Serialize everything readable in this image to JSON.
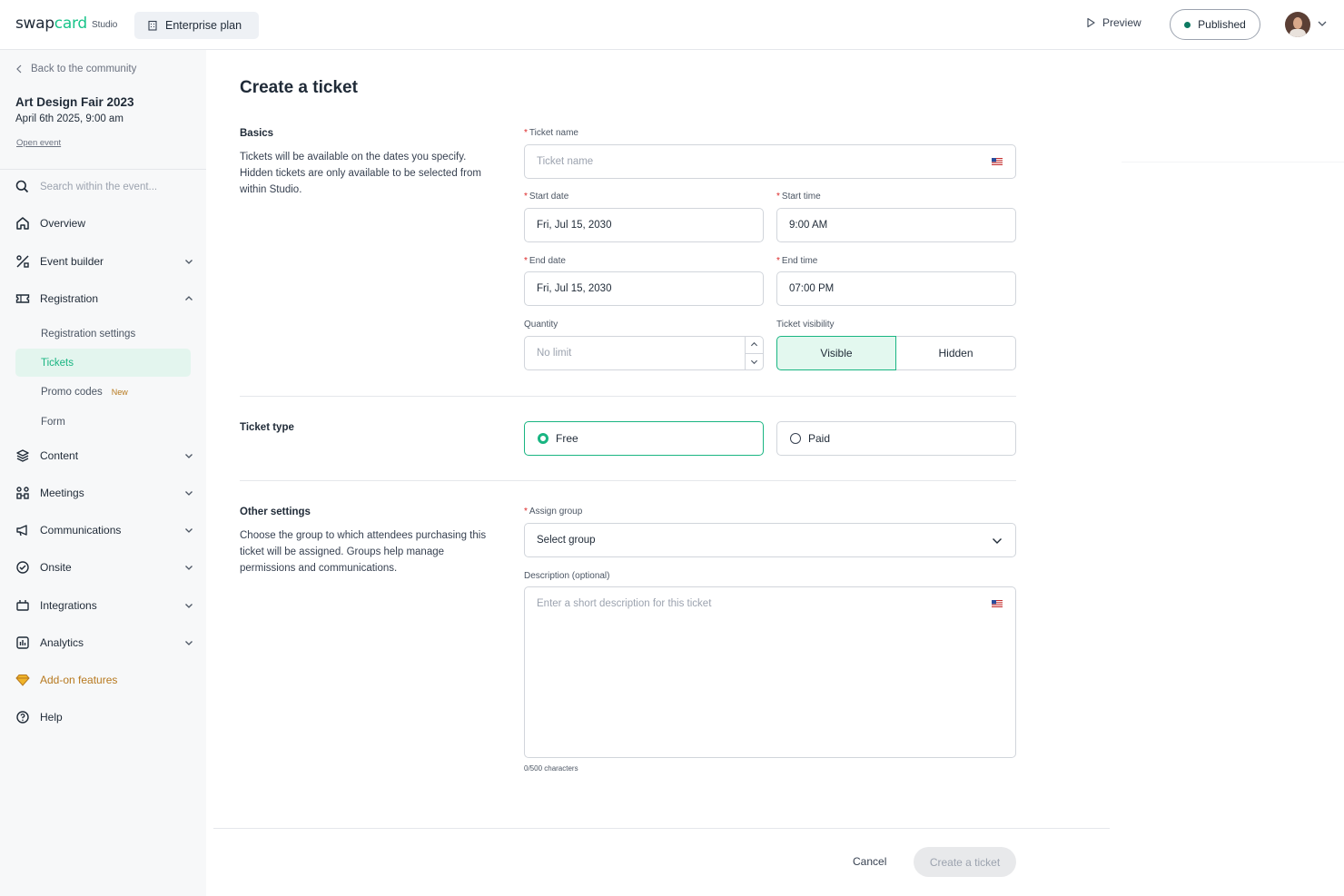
{
  "topbar": {
    "logo_text_a": "swap",
    "logo_text_b": "card",
    "studio_label": "Studio",
    "plan_label": "Enterprise plan",
    "preview_label": "Preview",
    "published_label": "Published",
    "status_color": "#0e7a62"
  },
  "sidebar": {
    "back_label": "Back to the community",
    "event_title": "Art Design Fair 2023",
    "event_date": "April 6th 2025, 9:00 am",
    "open_event_label": "Open event",
    "search_placeholder": "Search within the event...",
    "items": [
      {
        "label": "Overview",
        "icon": "home-icon"
      },
      {
        "label": "Event builder",
        "icon": "tools-icon"
      },
      {
        "label": "Registration",
        "icon": "ticket-icon"
      },
      {
        "label": "Content",
        "icon": "layers-icon"
      },
      {
        "label": "Meetings",
        "icon": "meetings-icon"
      },
      {
        "label": "Communications",
        "icon": "megaphone-icon"
      },
      {
        "label": "Onsite",
        "icon": "badge-check-icon"
      },
      {
        "label": "Integrations",
        "icon": "plug-icon"
      },
      {
        "label": "Analytics",
        "icon": "chart-icon"
      },
      {
        "label": "Add-on features",
        "icon": "diamond-icon"
      },
      {
        "label": "Help",
        "icon": "help-icon"
      }
    ],
    "registration_sub": [
      {
        "label": "Registration settings"
      },
      {
        "label": "Tickets",
        "active": true
      },
      {
        "label": "Promo codes",
        "badge": "New"
      },
      {
        "label": "Form"
      }
    ],
    "accent_color": "#19b582",
    "addon_color": "#b7791f"
  },
  "main": {
    "title": "Create a ticket",
    "basics": {
      "title": "Basics",
      "description": "Tickets will be available on the dates you specify. Hidden tickets are only available to be selected from within Studio.",
      "ticket_name_label": "Ticket name",
      "ticket_name_placeholder": "Ticket name",
      "start_date_label": "Start date",
      "start_date_value": "Fri, Jul 15, 2030",
      "start_time_label": "Start time",
      "start_time_value": "9:00 AM",
      "end_date_label": "End date",
      "end_date_value": "Fri, Jul 15, 2030",
      "end_time_label": "End time",
      "end_time_value": "07:00 PM",
      "quantity_label": "Quantity",
      "quantity_placeholder": "No limit",
      "visibility_label": "Ticket visibility",
      "visible_label": "Visible",
      "hidden_label": "Hidden",
      "visibility_selected": "Visible"
    },
    "ticket_type": {
      "title": "Ticket type",
      "free_label": "Free",
      "paid_label": "Paid",
      "selected": "Free"
    },
    "other": {
      "title": "Other settings",
      "description": "Choose the group to which attendees purchasing this ticket will be assigned. Groups help manage permissions and communications.",
      "assign_group_label": "Assign group",
      "assign_group_value": "Select group",
      "description_label": "Description (optional)",
      "description_placeholder": "Enter a short description for this ticket",
      "char_counter": "0/500 characters"
    },
    "footer": {
      "cancel_label": "Cancel",
      "create_label": "Create a ticket"
    }
  }
}
